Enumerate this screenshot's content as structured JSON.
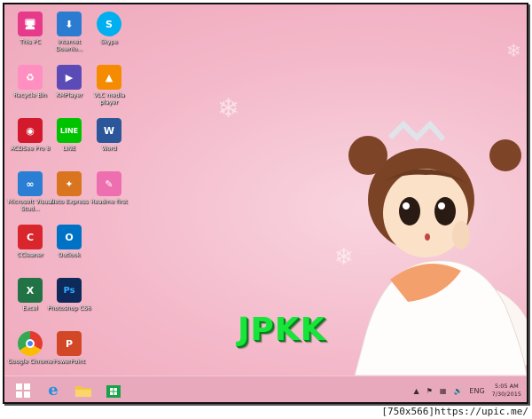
{
  "desktop": {
    "icons": [
      {
        "name": "this-pc",
        "label": "This PC",
        "color": "#e73a8a"
      },
      {
        "name": "internet-download-manager",
        "label": "Internet Downlo...",
        "color": "#2b7bd1"
      },
      {
        "name": "skype",
        "label": "Skype",
        "color": "#00aff0"
      },
      {
        "name": "recycle-bin",
        "label": "Recycle Bin",
        "color": "#ff8fc0"
      },
      {
        "name": "kmplayer",
        "label": "KMPlayer",
        "color": "#5b4bb7"
      },
      {
        "name": "vlc",
        "label": "VLC media player",
        "color": "#f48b00"
      },
      {
        "name": "acdsee",
        "label": "ACDSee Pro 8",
        "color": "#d21a2c"
      },
      {
        "name": "line",
        "label": "LINE",
        "color": "#00c300"
      },
      {
        "name": "word",
        "label": "Word",
        "color": "#2b579a"
      },
      {
        "name": "visual-studio",
        "label": "Microsoft Visual Stud...",
        "color": "#2a7fd4"
      },
      {
        "name": "neto-express",
        "label": "Neto Express",
        "color": "#d9741f"
      },
      {
        "name": "readme",
        "label": "Readme first",
        "color": "#ee6fb0"
      },
      {
        "name": "ccleaner",
        "label": "CCleaner",
        "color": "#d8262c"
      },
      {
        "name": "outlook",
        "label": "Outlook",
        "color": "#0072c6"
      },
      {
        "name": "excel",
        "label": "Excel",
        "color": "#217346"
      },
      {
        "name": "photoshop",
        "label": "Photoshop CS6",
        "color": "#0d2a5a"
      },
      {
        "name": "chrome",
        "label": "Google Chrome",
        "color": "#e33b2e"
      },
      {
        "name": "powerpoint",
        "label": "PowerPoint",
        "color": "#d24726"
      }
    ]
  },
  "wallpaper": {
    "brand_text": "JPKK"
  },
  "taskbar": {
    "apps": [
      "start",
      "internet-explorer",
      "file-explorer",
      "store"
    ],
    "tray": {
      "language": "ENG",
      "time": "5:05 AM",
      "date": "7/30/2015"
    }
  },
  "watermark": "[750x566]https://upic.me/"
}
